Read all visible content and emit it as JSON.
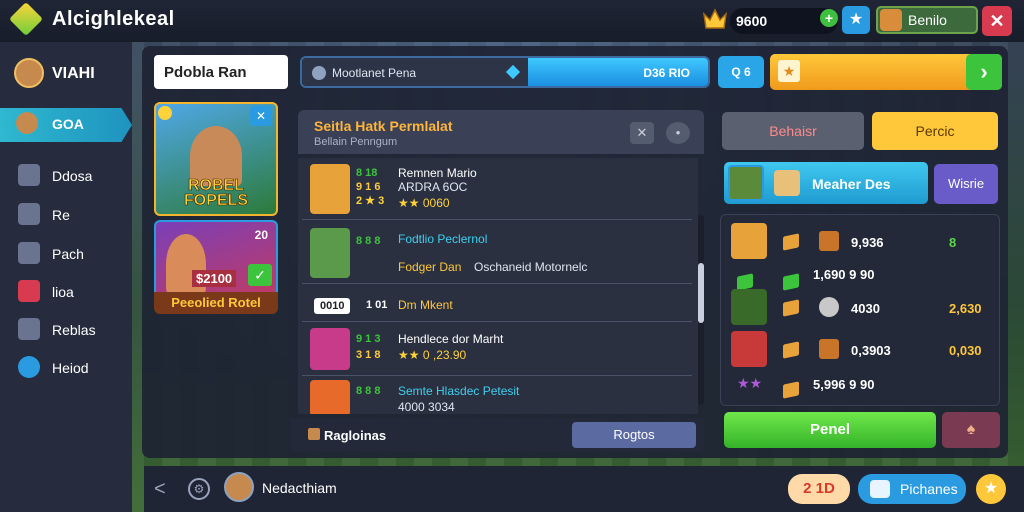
{
  "app": {
    "title": "Alcighlekeal"
  },
  "topbar": {
    "coins": "9600",
    "coin_plus_icon": "+",
    "star_icon": "★",
    "profile_name": "Benilo",
    "close_icon": "✕"
  },
  "sidebar": {
    "user_label": "VIAHI",
    "items": [
      {
        "label": "GOA",
        "icon": "player-icon",
        "active": true
      },
      {
        "label": "Ddosa",
        "icon": "document-icon"
      },
      {
        "label": "Re",
        "icon": "chat-icon"
      },
      {
        "label": "Pach",
        "icon": "megaphone-icon"
      },
      {
        "label": "lioa",
        "icon": "shield-icon"
      },
      {
        "label": "Reblas",
        "icon": "puzzle-icon"
      },
      {
        "label": "Heiod",
        "icon": "alarm-icon"
      }
    ]
  },
  "toolbar": {
    "search_value": "Pdobla Ran",
    "progress_label": "Mootlanet Pena",
    "progress_value": "D36 RIO",
    "progress_fraction": 0.45,
    "chip_label": "Q 6"
  },
  "cards": {
    "card1_title": "ROBEL FOPELS",
    "card2_number": "20",
    "card2_price": "$2100",
    "card2_label": "Peeolied Rotel"
  },
  "list": {
    "header_title": "Seitla Hatk Permlalat",
    "header_subtitle": "Bellain Penngum",
    "rows": [
      {
        "meta1": "8 18",
        "meta2": "9 1 6",
        "meta3": "2 ★ 3",
        "name": "Remnen Mario",
        "sub1": "ARDRA 6OC",
        "sub2": "★★ 0060"
      },
      {
        "meta1": "8 8 8",
        "meta2": "",
        "name": "Fodtlio Peclernol",
        "sub1": "Fodger Dan",
        "sub2": "Oschaneid Motornelc"
      },
      {
        "meta1": "0010",
        "meta2": "1 01",
        "name": "Dm Mkent",
        "sub1": "",
        "sub2": ""
      },
      {
        "meta1": "9 1 3",
        "meta2": "3 1 8",
        "name": "Hendlece dor Marht",
        "sub1": "★★ 0 ,23.90",
        "sub2": ""
      },
      {
        "meta1": "8 8 8",
        "meta2": "",
        "name": "Semte Hlasdec Petesit",
        "sub1": "4000 3034",
        "sub2": ""
      }
    ],
    "footer_label": "Ragloinas",
    "footer_button": "Rogtos"
  },
  "right": {
    "btn1": "Behaisr",
    "btn2": "Percic",
    "tag_label": "Meaher Des",
    "tag_button": "Wisrie",
    "stats": [
      {
        "v1": "9,936",
        "v2": "8"
      },
      {
        "v1": "1,690 9 90",
        "v2": ""
      },
      {
        "v1": "4030",
        "v2": "2,630"
      },
      {
        "v1": "0,3903",
        "v2": "0,030"
      },
      {
        "v1": "5,996 9 90",
        "v2": ""
      }
    ],
    "primary": "Penel",
    "secondary_icon": "♠"
  },
  "bottombar": {
    "back_icon": "<",
    "settings_icon": "⚙",
    "name": "Nedacthiam",
    "count": "2 1D",
    "cta": "Pichanes",
    "star_icon": "★"
  },
  "colors": {
    "accent": "#2aa5e8",
    "gold": "#ffc73a",
    "green": "#3cc43c",
    "danger": "#d83a4f"
  }
}
